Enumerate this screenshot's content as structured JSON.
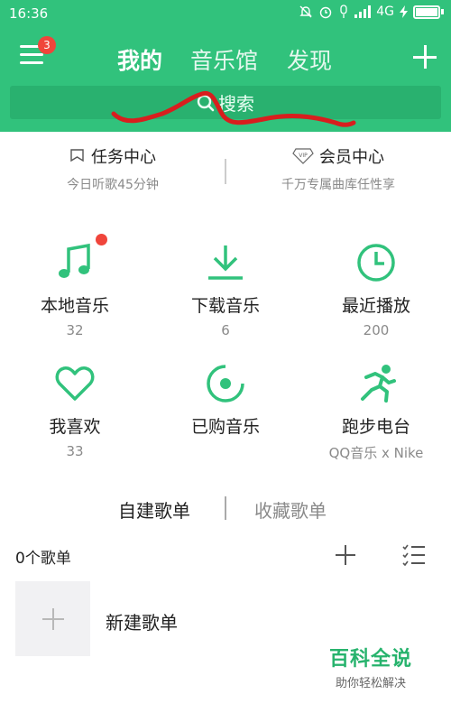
{
  "status_bar": {
    "time": "16:36",
    "network": "4G"
  },
  "header": {
    "menu_badge": "3",
    "tabs": [
      {
        "label": "我的",
        "active": true
      },
      {
        "label": "音乐馆",
        "active": false
      },
      {
        "label": "发现",
        "active": false
      }
    ],
    "search_placeholder": "搜索"
  },
  "quick": {
    "task": {
      "title": "任务中心",
      "subtitle": "今日听歌45分钟"
    },
    "vip": {
      "title": "会员中心",
      "subtitle": "千万专属曲库任性享",
      "badge": "VIP"
    }
  },
  "grid": [
    {
      "label": "本地音乐",
      "count": "32",
      "icon": "music-note-icon"
    },
    {
      "label": "下载音乐",
      "count": "6",
      "icon": "download-icon"
    },
    {
      "label": "最近播放",
      "count": "200",
      "icon": "clock-icon"
    },
    {
      "label": "我喜欢",
      "count": "33",
      "icon": "heart-icon"
    },
    {
      "label": "已购音乐",
      "count": "",
      "icon": "disc-icon"
    },
    {
      "label": "跑步电台",
      "count": "QQ音乐 x Nike",
      "icon": "runner-icon"
    }
  ],
  "playlists": {
    "tabs": [
      {
        "label": "自建歌单",
        "active": true
      },
      {
        "label": "收藏歌单",
        "active": false
      }
    ],
    "count_label": "0个歌单",
    "new_label": "新建歌单"
  },
  "watermark": {
    "title": "百科全说",
    "subtitle": "助你轻松解决"
  },
  "colors": {
    "brand_green": "#31c27c",
    "badge_red": "#f0453b",
    "icon_green": "#31c27c",
    "scribble_red": "#d81e1e"
  }
}
